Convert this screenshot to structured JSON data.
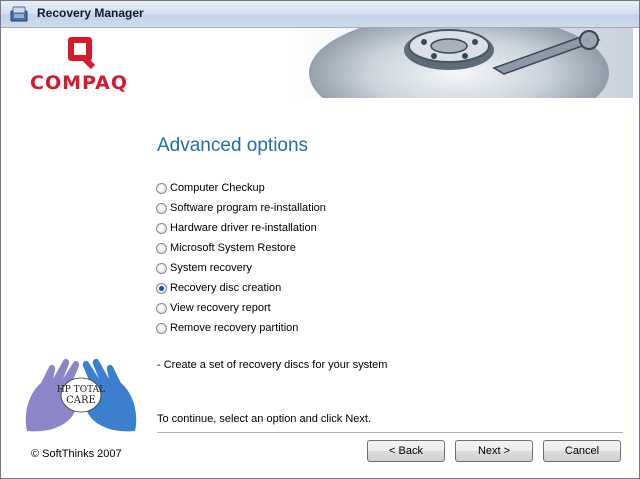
{
  "window": {
    "title": "Recovery Manager"
  },
  "brand": {
    "logo_text": "COMPAQ",
    "logo_color": "#d7192d",
    "care_text": "HP TOTAL CARE"
  },
  "main": {
    "heading": "Advanced options",
    "options": [
      {
        "label": "Computer Checkup",
        "selected": false
      },
      {
        "label": "Software program re-installation",
        "selected": false
      },
      {
        "label": "Hardware driver re-installation",
        "selected": false
      },
      {
        "label": "Microsoft System Restore",
        "selected": false
      },
      {
        "label": "System recovery",
        "selected": false
      },
      {
        "label": "Recovery disc creation",
        "selected": true
      },
      {
        "label": "View recovery report",
        "selected": false
      },
      {
        "label": "Remove recovery partition",
        "selected": false
      }
    ],
    "description": "- Create a set of recovery discs for your system",
    "instruction": "To continue, select an option and click Next."
  },
  "footer": {
    "copyright": "© SoftThinks 2007",
    "back_label": "< Back",
    "next_label": "Next >",
    "cancel_label": "Cancel"
  },
  "colors": {
    "heading": "#1f6fa8",
    "accent": "#1a4f9c"
  }
}
